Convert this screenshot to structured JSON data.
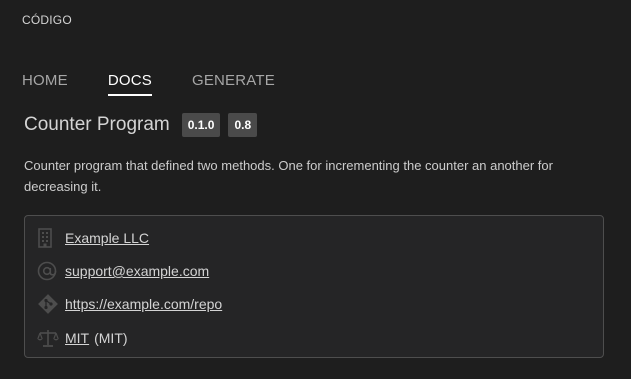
{
  "app": {
    "title": "CÓDIGO"
  },
  "tabs": [
    {
      "label": "HOME",
      "active": false
    },
    {
      "label": "DOCS",
      "active": true
    },
    {
      "label": "GENERATE",
      "active": false
    }
  ],
  "program": {
    "title": "Counter Program",
    "badges": [
      "0.1.0",
      "0.8"
    ],
    "description": "Counter program that defined two methods. One for incrementing the counter an another for decreasing it."
  },
  "info": {
    "organization": {
      "icon": "building-icon",
      "label": "Example LLC"
    },
    "email": {
      "icon": "at-sign-icon",
      "label": "support@example.com"
    },
    "repo": {
      "icon": "git-icon",
      "label": "https://example.com/repo"
    },
    "license": {
      "icon": "scales-icon",
      "label": "MIT",
      "suffix": "(MIT)"
    }
  },
  "colors": {
    "background": "#1e1e1e",
    "panel": "#252526",
    "border": "#4e4e4e",
    "badge": "#4a4a4a",
    "icon": "#4d4d4d",
    "text": "#d4d4d4"
  }
}
